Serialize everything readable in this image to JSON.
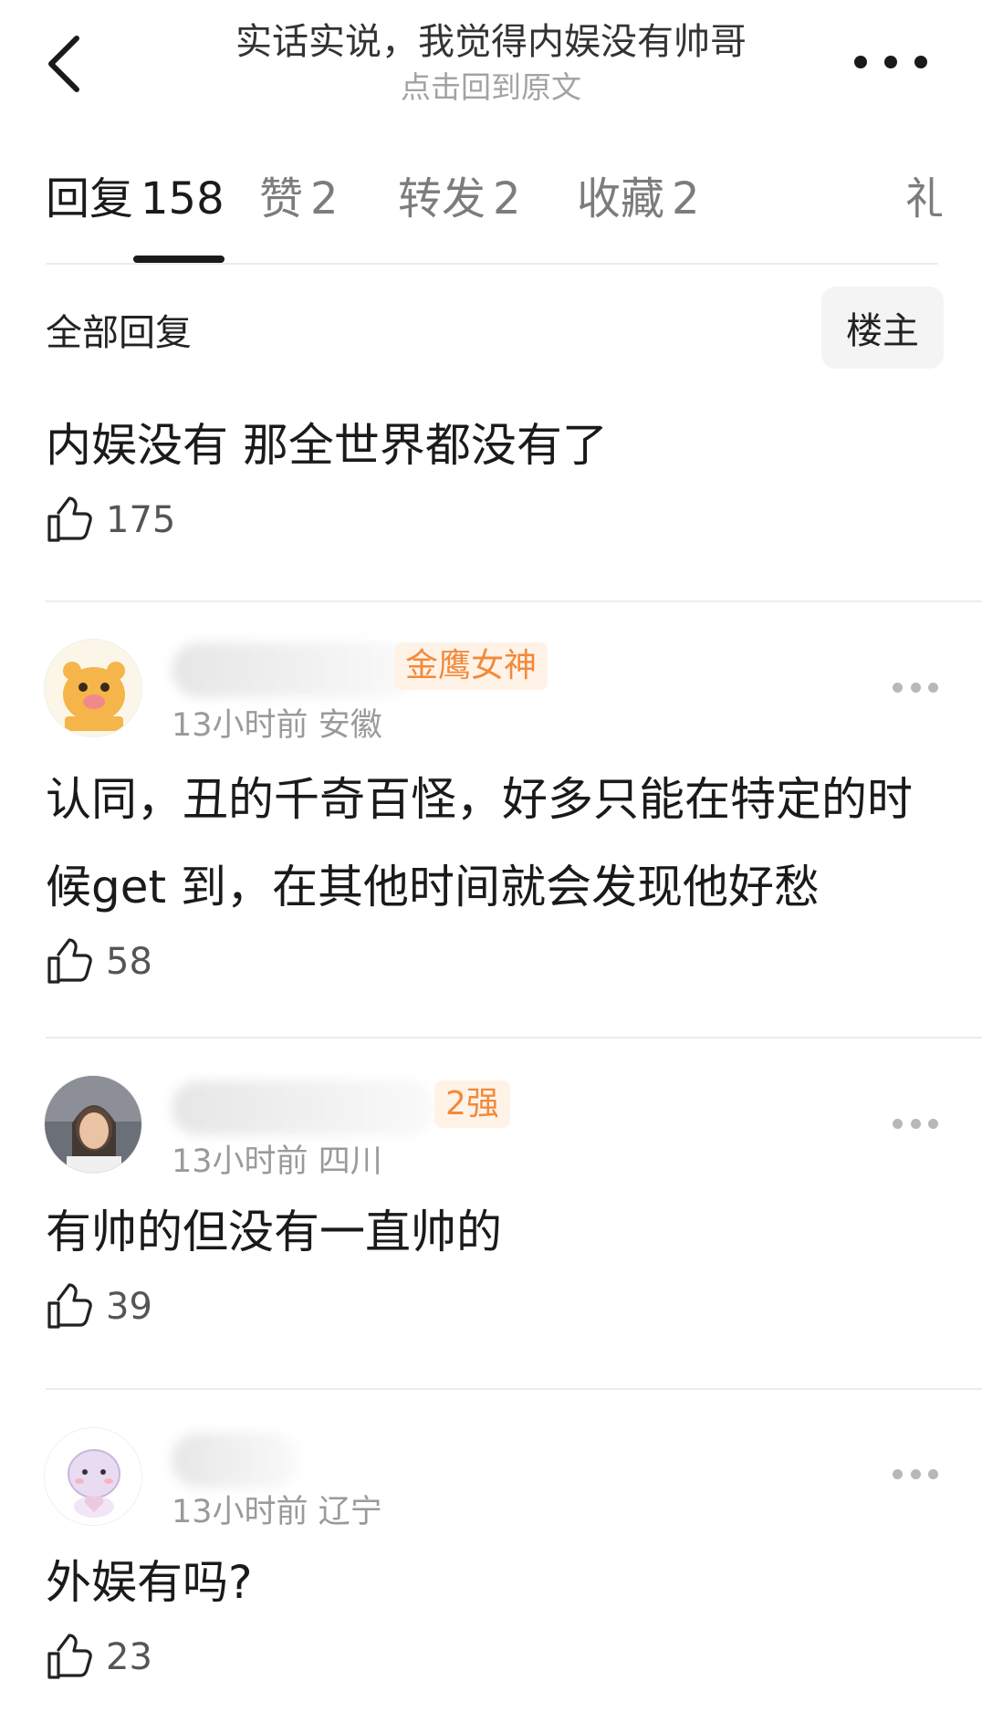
{
  "header": {
    "title": "实话实说，我觉得内娱没有帅哥",
    "subtitle": "点击回到原文"
  },
  "tabs": [
    {
      "label": "回复",
      "count": "158"
    },
    {
      "label": "赞",
      "count": "2"
    },
    {
      "label": "转发",
      "count": "2"
    },
    {
      "label": "收藏",
      "count": "2"
    },
    {
      "label": "礼",
      "count": ""
    }
  ],
  "filter": {
    "label": "全部回复",
    "op_button": "楼主"
  },
  "main_post": {
    "text": "内娱没有 那全世界都没有了",
    "likes": "175"
  },
  "comments": [
    {
      "badge": "金鹰女神",
      "time": "13小时前",
      "location": "安徽",
      "text": "认同，丑的千奇百怪，好多只能在特定的时候get 到，在其他时间就会发现他好愁",
      "likes": "58",
      "avatar": "pig-avatar"
    },
    {
      "badge": "2强",
      "time": "13小时前",
      "location": "四川",
      "text": "有帅的但没有一直帅的",
      "likes": "39",
      "avatar": "photo-avatar"
    },
    {
      "badge": "",
      "time": "13小时前",
      "location": "辽宁",
      "text": "外娱有吗?",
      "likes": "23",
      "avatar": "cartoon-avatar"
    }
  ],
  "colors": {
    "badge": "#f28a3b",
    "muted": "#9a9a9a",
    "text": "#1a1a1a"
  }
}
